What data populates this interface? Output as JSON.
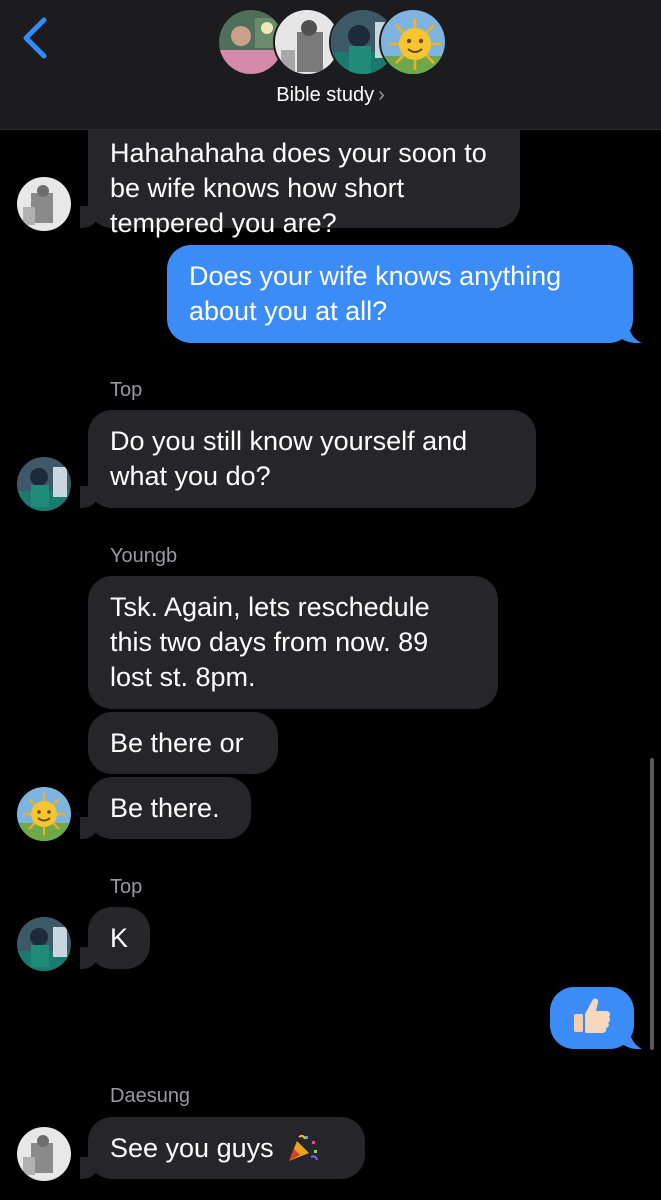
{
  "header": {
    "title": "Bible study"
  },
  "messages": [
    {
      "text": "Hahahahaha does your soon to be wife knows how short tempered you are?"
    },
    {
      "text": "Does your wife knows anything about you at all?"
    },
    {
      "sender": "Top",
      "text": "Do you still know yourself and what you do?"
    },
    {
      "sender": "Youngb",
      "text": "Tsk. Again, lets reschedule this two days from now. 89 lost st. 8pm."
    },
    {
      "text": "Be there or"
    },
    {
      "text": "Be there."
    },
    {
      "sender": "Top",
      "text": "K"
    },
    {
      "emoji": "thumbs-up"
    },
    {
      "sender": "Daesung",
      "text": "See you guys"
    }
  ],
  "colors": {
    "header_bg": "#1c1c1e",
    "incoming_bubble": "#26252a",
    "outgoing_bubble": "#3b8cf7",
    "accent": "#2f8cff"
  }
}
